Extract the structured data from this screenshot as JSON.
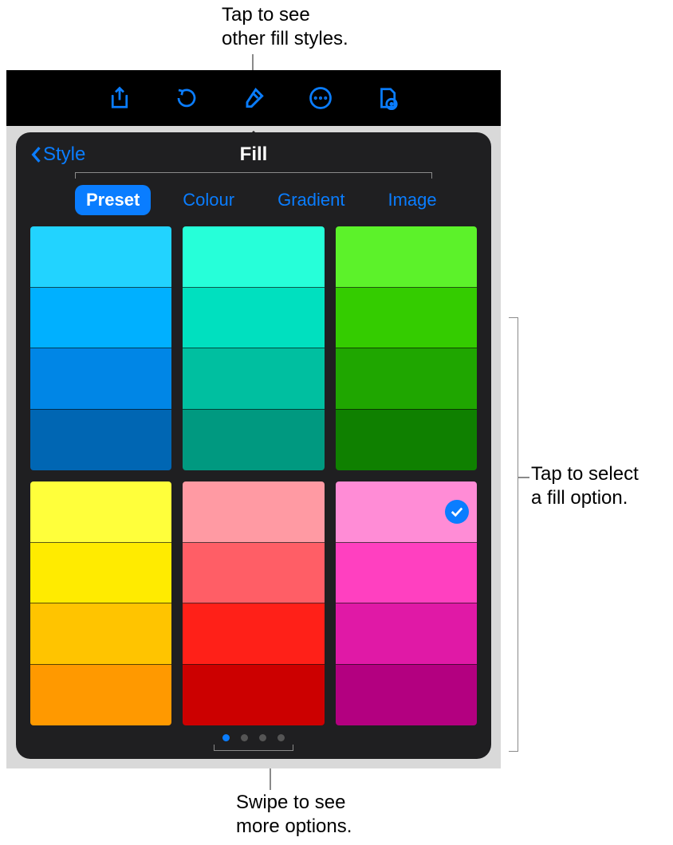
{
  "callouts": {
    "top": "Tap to see\nother fill styles.",
    "right": "Tap to select\na fill option.",
    "bottom": "Swipe to see\nmore options."
  },
  "toolbar_icons": [
    "share-icon",
    "undo-icon",
    "paintbrush-icon",
    "more-icon",
    "document-icon"
  ],
  "popover": {
    "back_label": "Style",
    "title": "Fill",
    "tabs": [
      {
        "label": "Preset",
        "selected": true
      },
      {
        "label": "Colour",
        "selected": false
      },
      {
        "label": "Gradient",
        "selected": false
      },
      {
        "label": "Image",
        "selected": false
      }
    ],
    "page_dots": {
      "count": 4,
      "active": 0
    },
    "selected_swatch": {
      "block": 5,
      "row": 0
    },
    "swatch_blocks": [
      {
        "name": "blue",
        "rows": [
          "#22d3ff",
          "#00b0ff",
          "#0086e6",
          "#0066b3"
        ]
      },
      {
        "name": "teal",
        "rows": [
          "#26ffd9",
          "#00e0bf",
          "#00bfa0",
          "#009980"
        ]
      },
      {
        "name": "green",
        "rows": [
          "#5cf22a",
          "#34cc00",
          "#1fa600",
          "#0f8000"
        ]
      },
      {
        "name": "yellow",
        "rows": [
          "#ffff3b",
          "#ffeb00",
          "#ffc400",
          "#ff9900"
        ]
      },
      {
        "name": "red",
        "rows": [
          "#ff9aa3",
          "#ff5e66",
          "#ff2018",
          "#cc0000"
        ]
      },
      {
        "name": "magenta",
        "rows": [
          "#ff8cd6",
          "#ff40c0",
          "#e019a6",
          "#b30080"
        ]
      }
    ]
  }
}
